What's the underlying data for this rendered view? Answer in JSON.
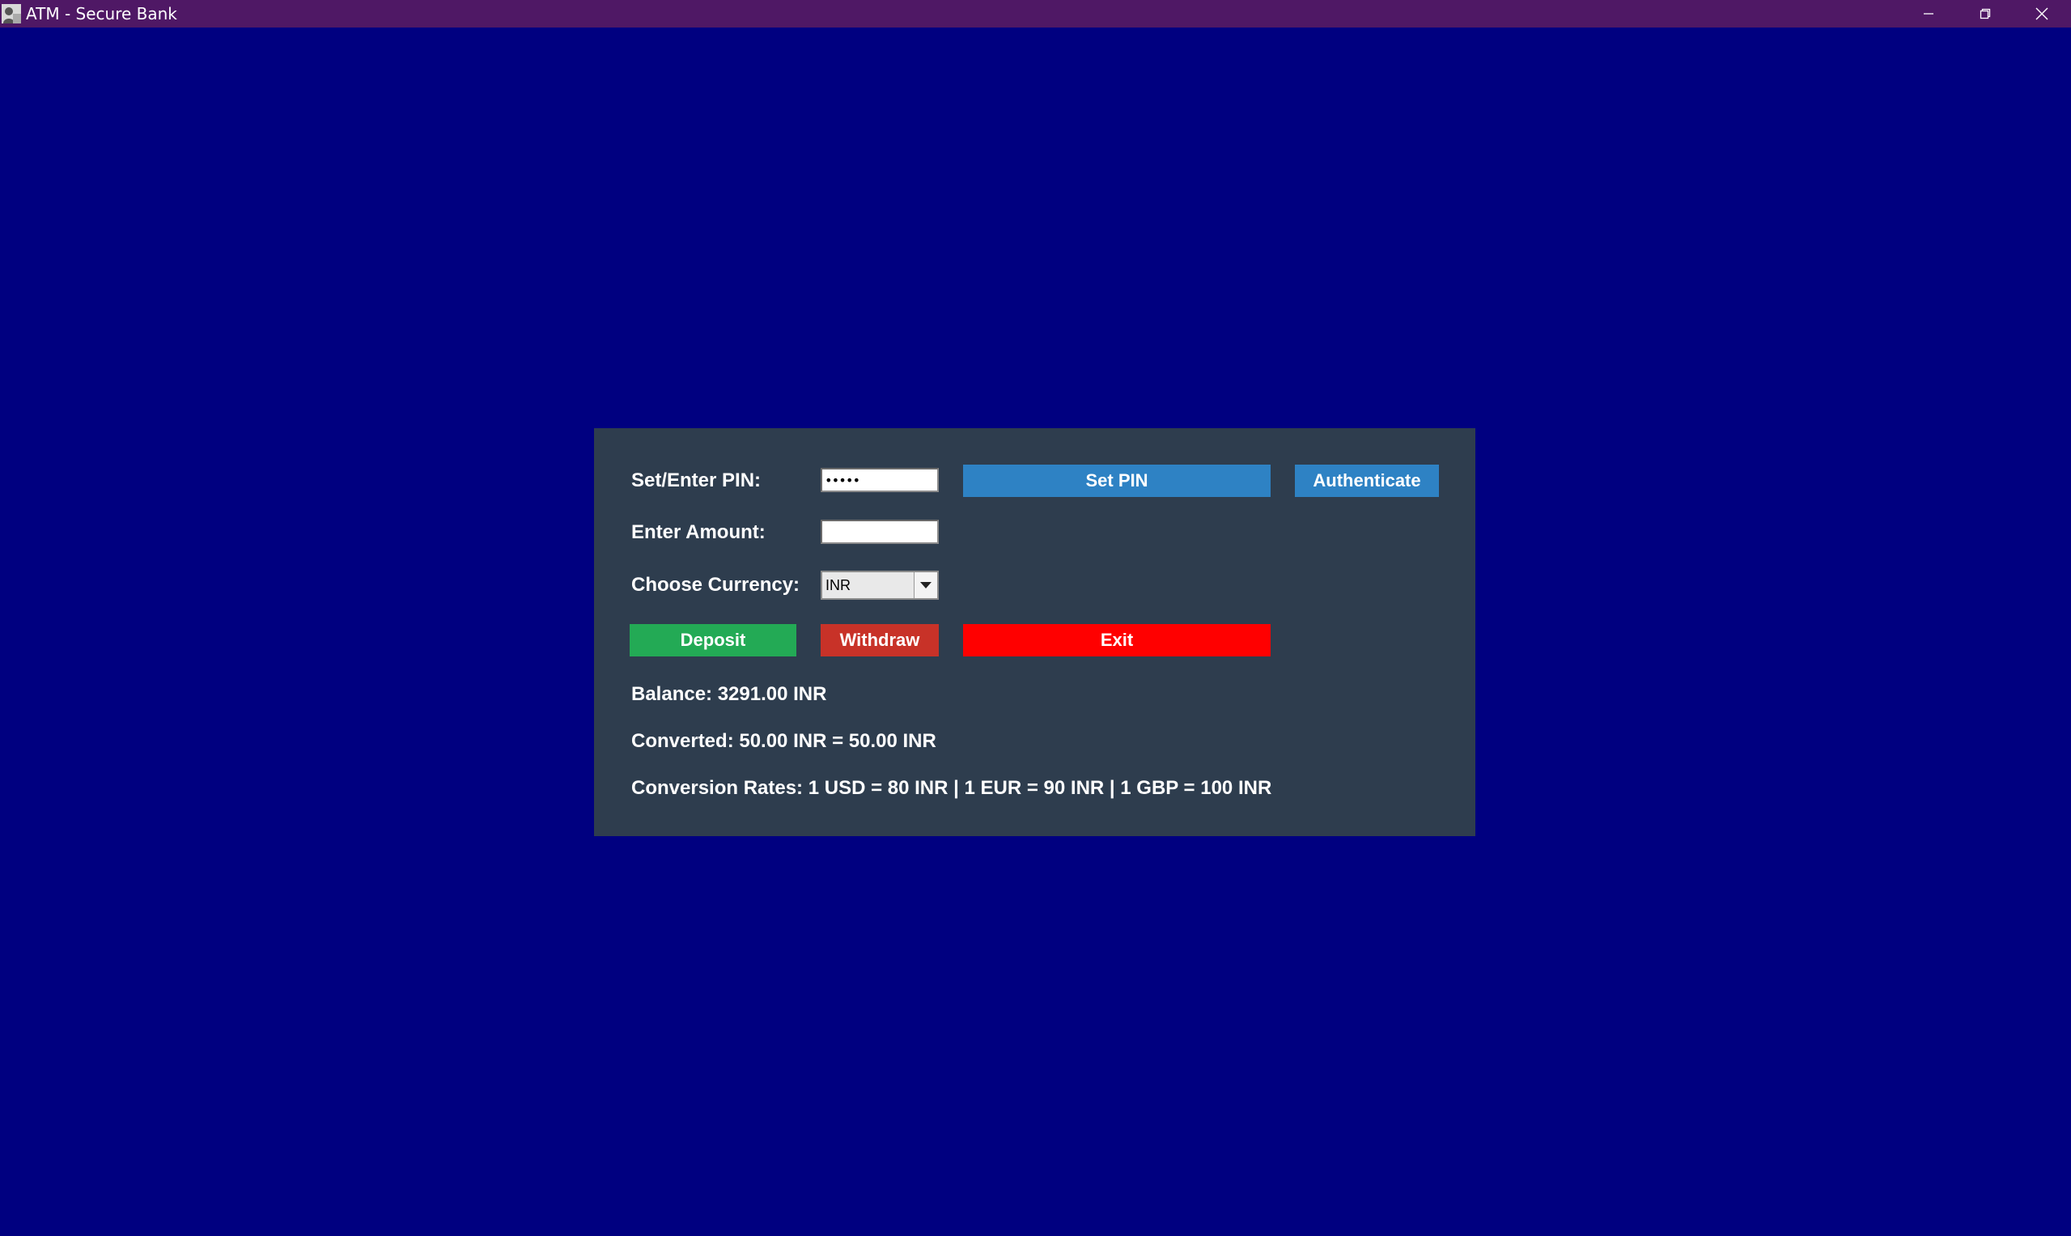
{
  "window": {
    "title": "ATM - Secure Bank",
    "app_icon": "user-avatar-icon",
    "controls": [
      "minimize-icon",
      "restore-icon",
      "close-icon"
    ]
  },
  "form": {
    "pin_label": "Set/Enter PIN:",
    "pin_value": "•••••",
    "amount_label": "Enter Amount:",
    "amount_value": "",
    "currency_label": "Choose Currency:",
    "currency_selected": "INR",
    "set_pin_label": "Set PIN",
    "authenticate_label": "Authenticate",
    "deposit_label": "Deposit",
    "withdraw_label": "Withdraw",
    "exit_label": "Exit"
  },
  "info": {
    "balance": "Balance: 3291.00 INR",
    "converted": "Converted: 50.00 INR = 50.00 INR",
    "rates": "Conversion Rates: 1 USD = 80 INR | 1 EUR = 90 INR | 1 GBP = 100 INR"
  },
  "colors": {
    "background": "#000080",
    "titlebar": "#4f1865",
    "panel": "#2e3d4e",
    "set_pin_button": "#2e82c4",
    "authenticate_button": "#2e82c4",
    "deposit_button": "#23aa55",
    "withdraw_button": "#c83228",
    "exit_button": "#ff0000"
  }
}
